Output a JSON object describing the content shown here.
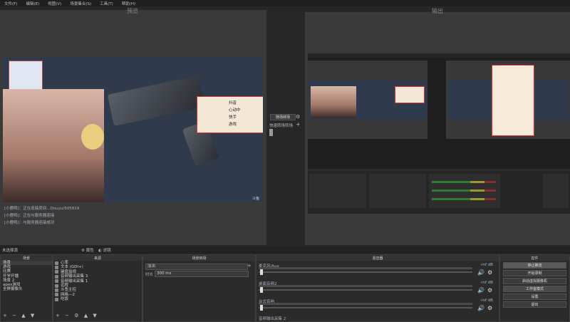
{
  "menu": [
    "文件(F)",
    "编辑(E)",
    "视图(V)",
    "场景集合(S)",
    "工具(T)",
    "帮助(H)"
  ],
  "panes": {
    "preview_title": "预览",
    "program_title": "输出"
  },
  "preview": {
    "watermark_small": "斗鱼",
    "sticker_lines": [
      "抖音",
      "心动中",
      "快手",
      "游戏"
    ],
    "chat": [
      "[小鹿鸭]：正在连接房间...Douyu/505819",
      "[小鹿鸭]：正在与服务器连接",
      "[小鹿鸭]：与服务器连接成功"
    ]
  },
  "transition_mid": {
    "label": "随场转场",
    "quick": "快速转场转场"
  },
  "status_bar": {
    "no_source": "未选择源",
    "prop_btn": "属性",
    "filter_btn": "滤镜"
  },
  "scenes": {
    "title": "场景",
    "items": [
      "场景",
      "游戏",
      "比赛",
      "开学开播",
      "场景 2",
      "apex游戏",
      "全屏摄像头"
    ]
  },
  "sources": {
    "title": "来源",
    "items": [
      "心率",
      "文本 (GDI+)",
      "键盘监视",
      "音频输出采集 3",
      "音频输出采集 1",
      "远程",
      "斗鱼主控",
      "网格—2",
      "吃饭"
    ]
  },
  "transitions": {
    "title": "场景转场",
    "type": "淡出",
    "duration_label": "时长",
    "duration": "300 ms"
  },
  "mixer": {
    "title": "混音器",
    "channels": [
      {
        "name": "麦克风/Aux",
        "db": "-inf dB"
      },
      {
        "name": "桌面音频2",
        "db": "-inf dB"
      },
      {
        "name": "台式音响",
        "db": "-inf dB"
      },
      {
        "name": "音频输出采集 2",
        "db": ""
      }
    ]
  },
  "controls": {
    "title": "控件",
    "buttons": [
      "停止推流",
      "开始录制",
      "启动虚拟摄像机",
      "工作室模式",
      "设置",
      "退出"
    ]
  },
  "footer_icons": [
    "+",
    "−",
    "▲",
    "▼"
  ]
}
